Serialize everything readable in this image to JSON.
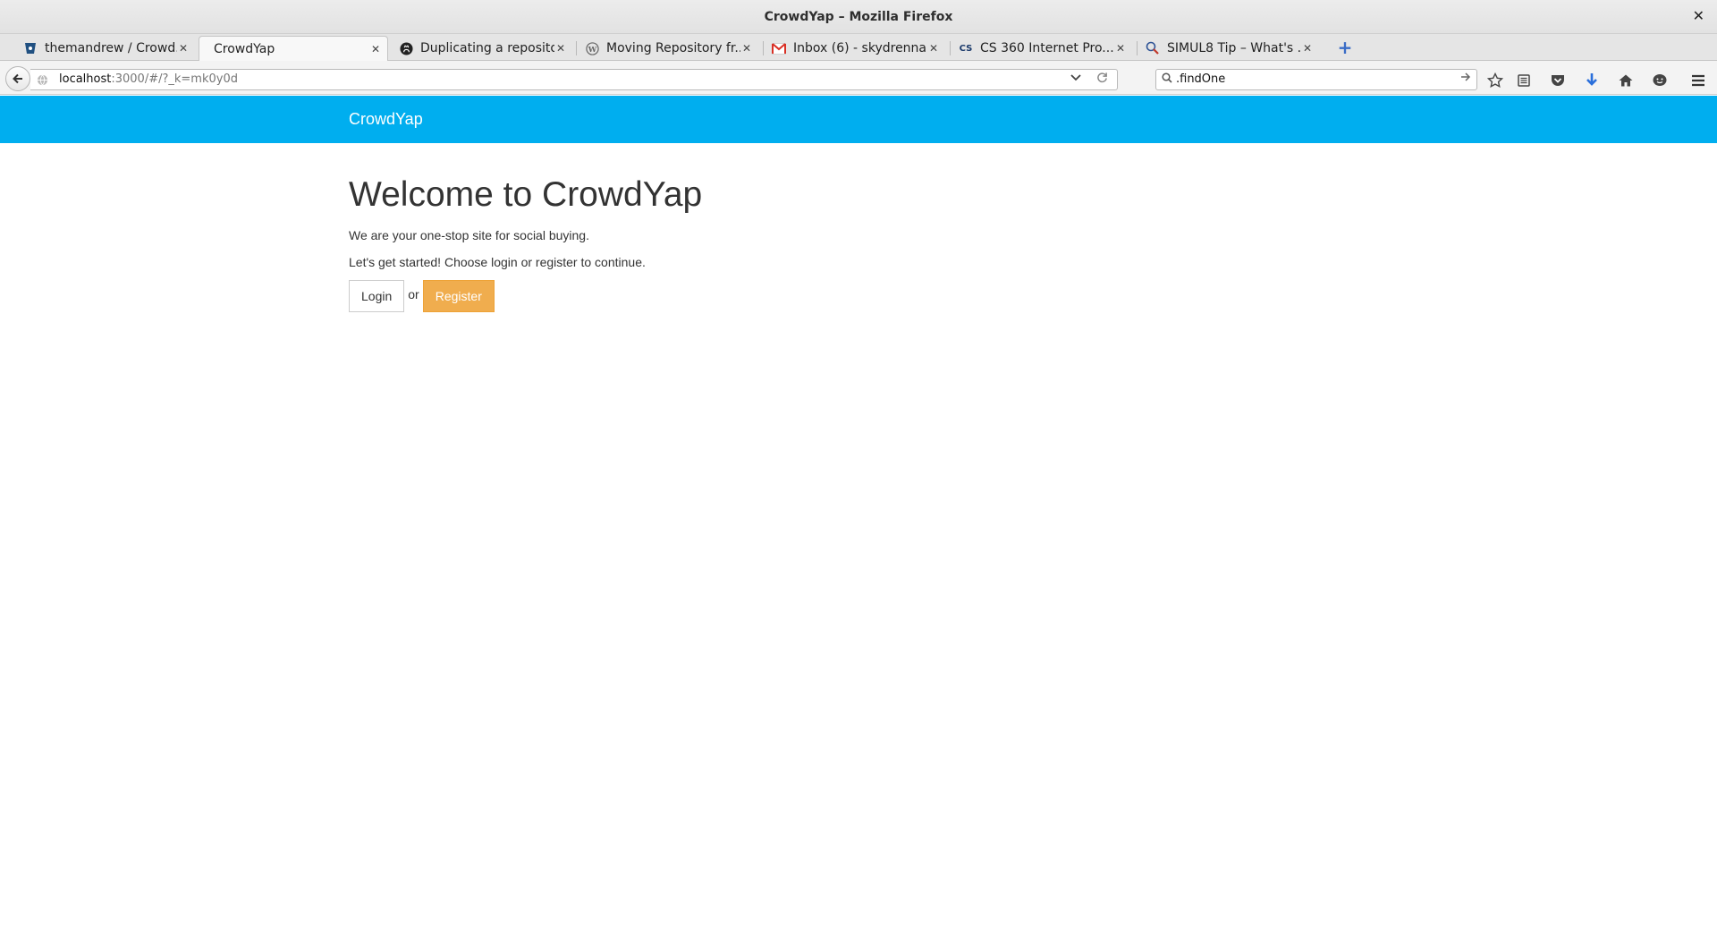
{
  "window": {
    "title": "CrowdYap – Mozilla Firefox"
  },
  "tabs": [
    {
      "label": "themandrew / Crowd...",
      "favicon": "bitbucket-icon"
    },
    {
      "label": "CrowdYap",
      "favicon": "blank-page-icon",
      "active": true
    },
    {
      "label": "Duplicating a reposito...",
      "favicon": "github-icon"
    },
    {
      "label": "Moving Repository fr...",
      "favicon": "wordpress-icon"
    },
    {
      "label": "Inbox (6) - skydrenna...",
      "favicon": "gmail-icon"
    },
    {
      "label": "CS 360 Internet Pro...",
      "favicon": "cs-icon",
      "favicon_text": "CS"
    },
    {
      "label": "SIMUL8 Tip – What's ...",
      "favicon": "simul8-icon"
    }
  ],
  "navbar": {
    "url_host": "localhost",
    "url_rest": ":3000/#/?_k=mk0y0d",
    "search_value": ".findOne"
  },
  "page": {
    "brand": "CrowdYap",
    "heading": "Welcome to CrowdYap",
    "tagline": "We are your one-stop site for social buying.",
    "instruction": "Let's get started! Choose login or register to continue.",
    "login_label": "Login",
    "or_text": "or",
    "register_label": "Register"
  },
  "colors": {
    "header_bg": "#00aeef",
    "register_bg": "#f0ad4e"
  }
}
